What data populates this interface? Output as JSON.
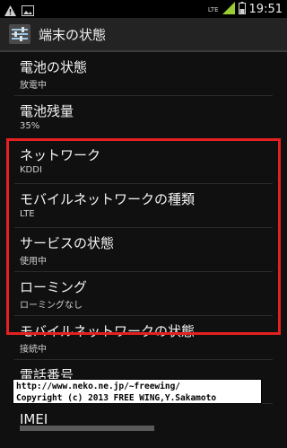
{
  "status_bar": {
    "network": "LTE",
    "time": "19:51"
  },
  "header": {
    "title": "端末の状態"
  },
  "items": [
    {
      "title": "電池の状態",
      "subtitle": "放電中"
    },
    {
      "title": "電池残量",
      "subtitle": "35%"
    },
    {
      "title": "ネットワーク",
      "subtitle": "KDDI"
    },
    {
      "title": "モバイルネットワークの種類",
      "subtitle": "LTE"
    },
    {
      "title": "サービスの状態",
      "subtitle": "使用中"
    },
    {
      "title": "ローミング",
      "subtitle": "ローミングなし"
    },
    {
      "title": "モバイルネットワークの状態",
      "subtitle": "接続中"
    },
    {
      "title": "電話番号",
      "subtitle": ""
    },
    {
      "title": "IMEI",
      "subtitle": ""
    }
  ],
  "watermark": {
    "line1": "http://www.neko.ne.jp/~freewing/",
    "line2": "Copyright (c) 2013 FREE WING,Y.Sakamoto"
  },
  "colors": {
    "highlight": "#e52020",
    "background": "#101010"
  }
}
